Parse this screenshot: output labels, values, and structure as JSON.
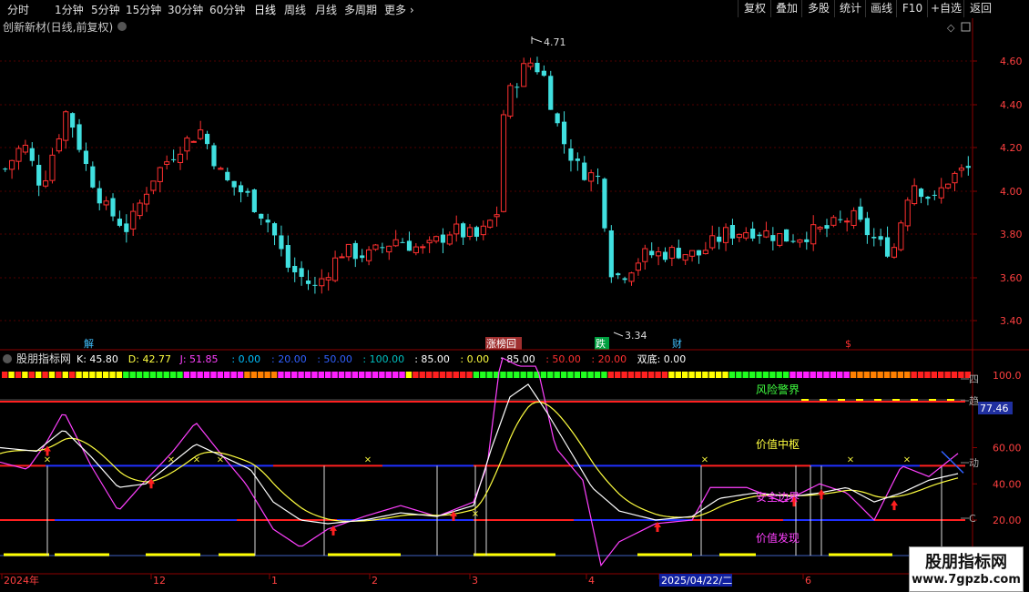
{
  "toolbar": {
    "periods": [
      "分时",
      "1分钟",
      "5分钟",
      "15分钟",
      "30分钟",
      "60分钟",
      "日线",
      "周线",
      "月线",
      "多周期",
      "更多 ›"
    ],
    "active_period": "日线",
    "buttons": [
      "复权",
      "叠加",
      "多股",
      "统计",
      "画线",
      "F10",
      "+自选",
      "返回"
    ]
  },
  "main": {
    "title": "创新新材(日线,前复权)",
    "price_axis": [
      "4.60",
      "4.40",
      "4.20",
      "4.00",
      "3.80",
      "3.60",
      "3.40"
    ],
    "high_marker": "4.71",
    "low_marker": "3.34",
    "event_tags": [
      {
        "text": "解",
        "color": "#40c0ff"
      },
      {
        "text": "涨榜回",
        "color": "#ffffff",
        "bg": "#a03030"
      },
      {
        "text": "跌",
        "color": "#ffffff",
        "bg": "#00a040"
      },
      {
        "text": "财",
        "color": "#40c0ff"
      },
      {
        "text": "$",
        "color": "#ff3030"
      }
    ]
  },
  "indicator": {
    "name": "股朋指标网",
    "values": [
      {
        "text": "K: 45.80",
        "color": "#ffffff"
      },
      {
        "text": "D: 42.77",
        "color": "#ffff40"
      },
      {
        "text": "J: 51.85",
        "color": "#ff40ff"
      },
      {
        "text": ": 0.00",
        "color": "#00c0ff"
      },
      {
        "text": ": 20.00",
        "color": "#3060ff"
      },
      {
        "text": ": 50.00",
        "color": "#3060ff"
      },
      {
        "text": ": 100.00",
        "color": "#00c0c0"
      },
      {
        "text": ": 85.00",
        "color": "#ffffff"
      },
      {
        "text": ": 0.00",
        "color": "#ffff40"
      },
      {
        "text": ": 85.00",
        "color": "#ffffff"
      },
      {
        "text": ": 50.00",
        "color": "#ff3030"
      },
      {
        "text": ": 20.00",
        "color": "#ff3030"
      },
      {
        "text": "双底: 0.00",
        "color": "#ffffff"
      }
    ],
    "axis": [
      "100.0",
      "60.00",
      "40.00",
      "20.00"
    ],
    "current_badge": "77.46",
    "zone_labels": [
      {
        "text": "风险警界",
        "color": "#40ff40"
      },
      {
        "text": "价值中枢",
        "color": "#ffff40"
      },
      {
        "text": "安全边界",
        "color": "#ff40ff"
      },
      {
        "text": "价值发现",
        "color": "#ff40ff"
      }
    ],
    "right_tags": [
      "四",
      "趋",
      "动",
      "C"
    ]
  },
  "date_axis": {
    "labels": [
      "2024年",
      "12",
      "1",
      "2",
      "3",
      "4",
      "2025/04/22/二",
      "6"
    ],
    "highlight": "2025/04/22/二"
  },
  "watermark": {
    "title": "股朋指标网",
    "url": "www.7gpzb.com"
  },
  "colors": {
    "up": "#ff3030",
    "down": "#40e0e0",
    "grid": "#500000",
    "kline_bg": "#000000"
  }
}
